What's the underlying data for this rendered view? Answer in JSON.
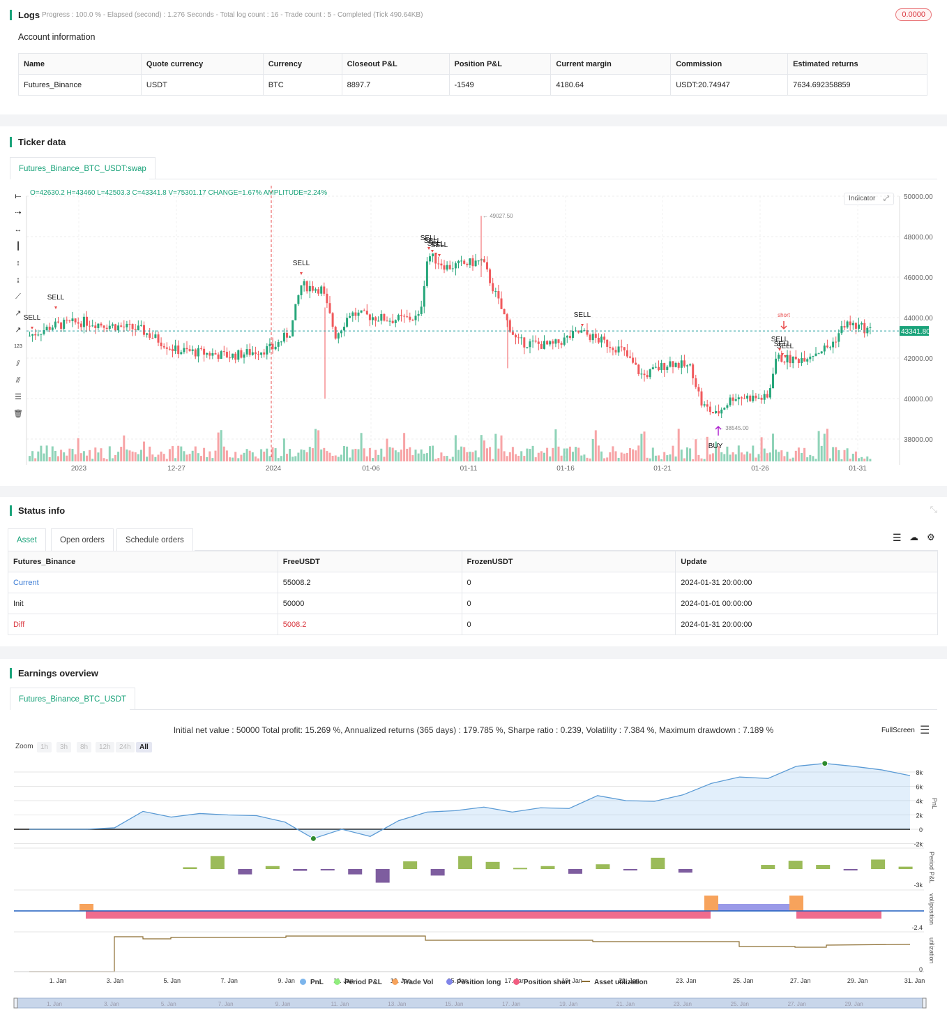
{
  "logs": {
    "title": "Logs",
    "progress": "Progress : 100.0 % - Elapsed (second) : 1.276  Seconds - Total log count : 16 - Trade count : 5 - Completed (Tick 490.64KB)",
    "badge": "0.0000"
  },
  "account": {
    "title": "Account information",
    "headers": [
      "Name",
      "Quote currency",
      "Currency",
      "Closeout P&L",
      "Position P&L",
      "Current margin",
      "Commission",
      "Estimated returns"
    ],
    "row": [
      "Futures_Binance",
      "USDT",
      "BTC",
      "8897.7",
      "-1549",
      "4180.64",
      "USDT:20.74947",
      "7634.692358859"
    ]
  },
  "ticker": {
    "title": "Ticker data",
    "tab": "Futures_Binance_BTC_USDT:swap",
    "ohlc": "O=42630.2 H=43460 L=42503.3 C=43341.8 V=75301.17 CHANGE=1.67% AMPLITUDE=2.24%",
    "indicator_btn": "Indicator",
    "last_price": "43341.80",
    "y_ticks": [
      "50000.00",
      "48000.00",
      "46000.00",
      "44000.00",
      "42000.00",
      "40000.00",
      "38000.00"
    ],
    "x_ticks": [
      "2023",
      "12-27",
      "2024",
      "01-06",
      "01-11",
      "01-16",
      "01-21",
      "01-26",
      "01-31"
    ],
    "high_label": "49027.50",
    "low_label": "38545.00",
    "signals": {
      "sell": "SELL",
      "buy": "BUY",
      "short": "short"
    }
  },
  "status": {
    "title": "Status info",
    "tabs": [
      "Asset",
      "Open orders",
      "Schedule orders"
    ],
    "headers": [
      "Futures_Binance",
      "FreeUSDT",
      "FrozenUSDT",
      "Update"
    ],
    "rows": [
      [
        "Current",
        "55008.2",
        "0",
        "2024-01-31 20:00:00"
      ],
      [
        "Init",
        "50000",
        "0",
        "2024-01-01 00:00:00"
      ],
      [
        "Diff",
        "5008.2",
        "0",
        "2024-01-31 20:00:00"
      ]
    ],
    "colors": {
      "current": "#3a7bd5",
      "diff": "#d9363e"
    }
  },
  "earnings": {
    "title": "Earnings overview",
    "tab": "Futures_Binance_BTC_USDT",
    "summary": "Initial net value : 50000 Total profit: 15.269 %, Annualized returns (365 days) : 179.785 %, Sharpe ratio : 0.239, Volatility : 7.384 %, Maximum drawdown : 7.189 %",
    "fullscreen": "FullScreen",
    "zoom_label": "Zoom",
    "zoom_options": [
      "1h",
      "3h",
      "8h",
      "12h",
      "24h",
      "All"
    ],
    "pnl_ticks": [
      "8k",
      "6k",
      "4k",
      "2k",
      "0",
      "-2k"
    ],
    "period_tick": "-3k",
    "vol_tick": "-2.4",
    "util_tick": "0",
    "axis_titles": [
      "PnL",
      "Period P&L",
      "vol/position",
      "utilization"
    ],
    "x_ticks": [
      "1. Jan",
      "3. Jan",
      "5. Jan",
      "7. Jan",
      "9. Jan",
      "11. Jan",
      "13. Jan",
      "15. Jan",
      "17. Jan",
      "19. Jan",
      "21. Jan",
      "23. Jan",
      "25. Jan",
      "27. Jan",
      "29. Jan",
      "31. Jan"
    ],
    "nav_ticks": [
      "1. Jan",
      "3. Jan",
      "5. Jan",
      "7. Jan",
      "9. Jan",
      "11. Jan",
      "13. Jan",
      "15. Jan",
      "17. Jan",
      "19. Jan",
      "21. Jan",
      "23. Jan",
      "25. Jan",
      "27. Jan",
      "29. Jan"
    ],
    "legend": [
      {
        "label": "PnL",
        "color": "#7cb5ec"
      },
      {
        "label": "Period P&L",
        "color": "#90ed7d"
      },
      {
        "label": "Trade Vol",
        "color": "#f7a35c"
      },
      {
        "label": "Position long",
        "color": "#8085e9"
      },
      {
        "label": "Position short",
        "color": "#f15c80"
      },
      {
        "label": "Asset utilization",
        "color": "#8c6d31"
      }
    ],
    "pnl_series": [
      0,
      0,
      0,
      200,
      2500,
      1700,
      2200,
      2000,
      1900,
      1000,
      -1300,
      0,
      -1000,
      1200,
      2400,
      2600,
      3100,
      2400,
      3000,
      2900,
      4700,
      4000,
      3900,
      4800,
      6400,
      7300,
      7100,
      8800,
      9200,
      8800,
      8300,
      7500
    ],
    "period_pnl": [
      0,
      0,
      0,
      300,
      2200,
      -900,
      500,
      -300,
      -100,
      -900,
      -2300,
      1300,
      -1100,
      2200,
      1200,
      200,
      500,
      -800,
      800,
      -100,
      1900,
      -600,
      0,
      0,
      700,
      1400,
      700,
      -200,
      1600,
      400,
      -400,
      -300,
      -700
    ],
    "chart_data": {
      "type": "line",
      "series": [
        {
          "name": "PnL",
          "values": [
            0,
            0,
            0,
            200,
            2500,
            1700,
            2200,
            2000,
            1900,
            1000,
            -1300,
            0,
            -1000,
            1200,
            2400,
            2600,
            3100,
            2400,
            3000,
            2900,
            4700,
            4000,
            3900,
            4800,
            6400,
            7300,
            7100,
            8800,
            9200,
            8800,
            8300,
            7500
          ]
        }
      ]
    }
  }
}
